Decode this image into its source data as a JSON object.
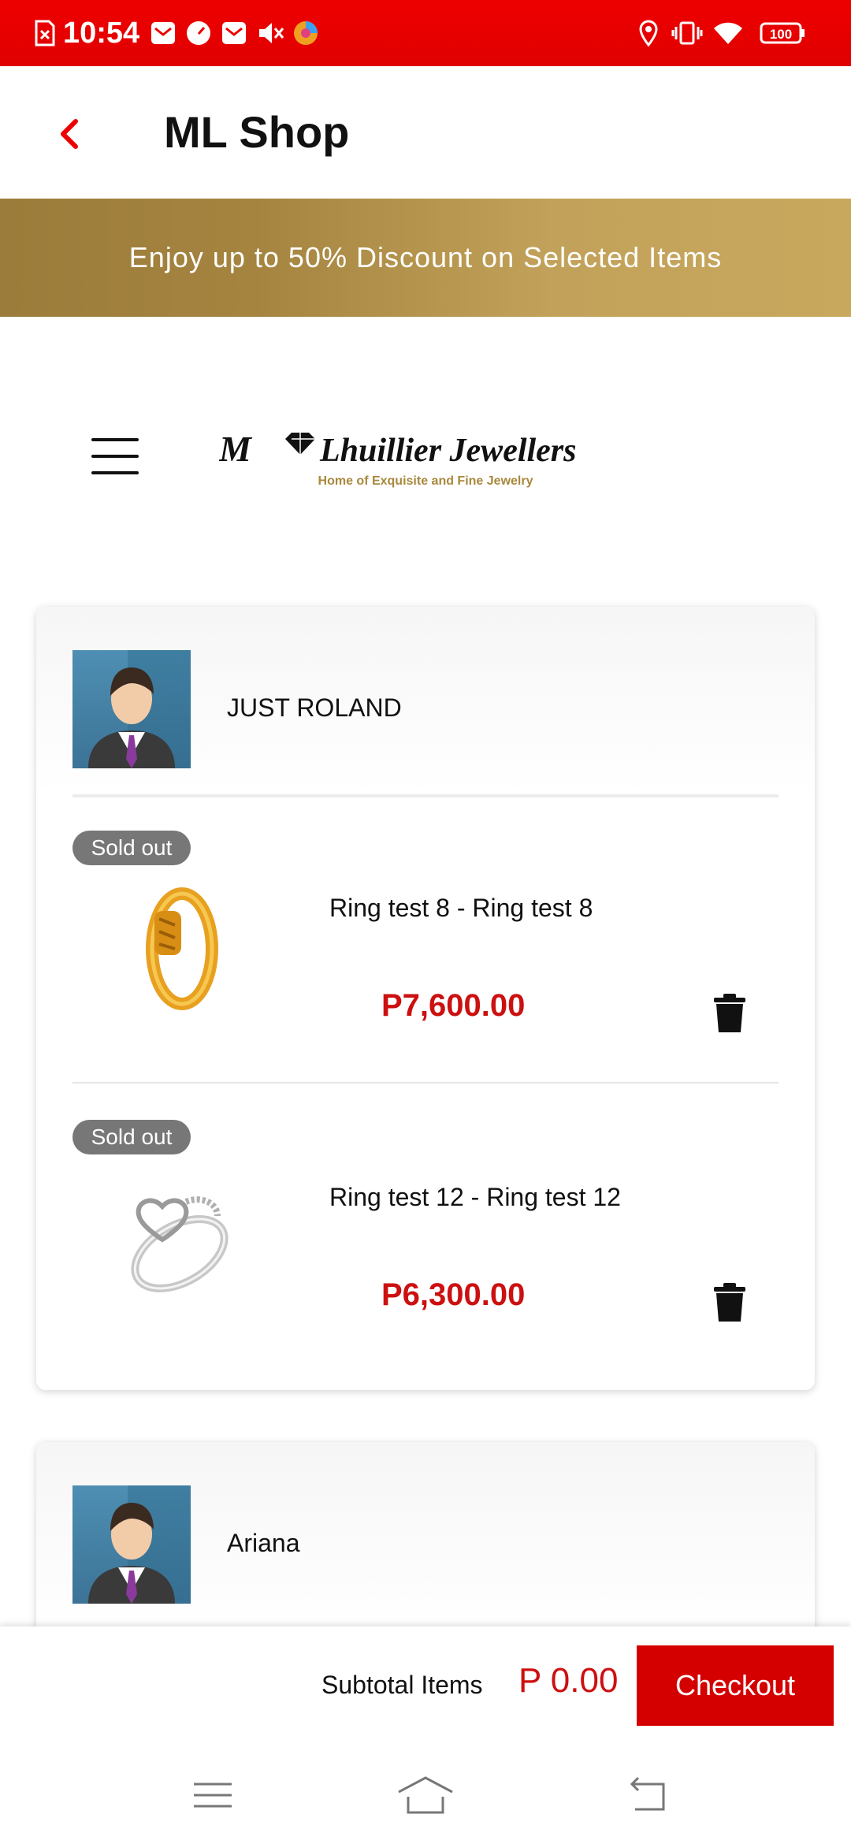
{
  "status_bar": {
    "time": "10:54",
    "battery": "100",
    "icons": [
      "screenshot-x-icon",
      "mail-icon",
      "speedometer-icon",
      "mail-icon",
      "mute-icon",
      "browser-icon",
      "location-icon",
      "vibrate-icon",
      "wifi-icon",
      "battery-icon"
    ]
  },
  "header": {
    "title": "ML Shop",
    "back_icon": "chevron-left-icon"
  },
  "banner": {
    "text": "Enjoy up to 50% Discount on Selected Items"
  },
  "brand": {
    "menu_icon": "hamburger-icon",
    "logo_name": "M Lhuillier Jewellers",
    "logo_tagline": "Home of Exquisite and Fine Jewelry"
  },
  "cart": {
    "sellers": [
      {
        "name": "JUST ROLAND",
        "items": [
          {
            "badge": "Sold out",
            "name": "Ring test 8 - Ring test 8",
            "price": "P7,600.00"
          },
          {
            "badge": "Sold out",
            "name": "Ring test 12 - Ring test 12",
            "price": "P6,300.00"
          }
        ]
      },
      {
        "name": "Ariana",
        "items": []
      }
    ]
  },
  "footer": {
    "subtotal_label": "Subtotal Items",
    "subtotal_value": "P 0.00",
    "checkout_label": "Checkout"
  },
  "colors": {
    "status_bar": "#e80000",
    "accent": "#cc1010",
    "checkout": "#d40000",
    "banner": "#b8974f"
  }
}
